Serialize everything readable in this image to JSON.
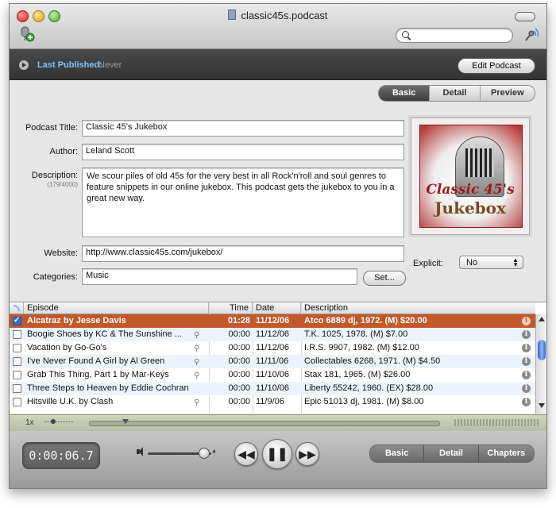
{
  "window": {
    "title": "classic45s.podcast",
    "search_placeholder": ""
  },
  "publish": {
    "label": "Last Published:",
    "value": "Never",
    "edit_button": "Edit Podcast"
  },
  "view_tabs": [
    {
      "label": "Basic",
      "active": true
    },
    {
      "label": "Detail",
      "active": false
    },
    {
      "label": "Preview",
      "active": false
    }
  ],
  "form": {
    "title_label": "Podcast Title:",
    "title_value": "Classic 45's Jukebox",
    "author_label": "Author:",
    "author_value": "Leland Scott",
    "description_label": "Description:",
    "description_count": "(179/4000)",
    "description_value": "We scour piles of old 45s for the very best in all Rock'n'roll and soul genres to feature snippets in our online jukebox.  This podcast gets the jukebox to you in a great new way.",
    "website_label": "Website:",
    "website_value": "http://www.classic45s.com/jukebox/",
    "categories_label": "Categories:",
    "categories_value": "Music",
    "set_button": "Set...",
    "explicit_label": "Explicit:",
    "explicit_value": "No",
    "artwork_text_top": "Classic 45's",
    "artwork_text_bottom": "Jukebox"
  },
  "table": {
    "columns": [
      "Episode",
      "Time",
      "Date",
      "Description"
    ],
    "rows": [
      {
        "episode": "Alcatraz by Jesse Davis",
        "time": "01:28",
        "date": "11/12/06",
        "description": "Atco 6889 dj, 1972. (M) $20.00",
        "checked": true,
        "selected": true,
        "clip": false
      },
      {
        "episode": "Boogie Shoes by KC & The Sunshine ...",
        "time": "00:00",
        "date": "11/12/06",
        "description": "T.K. 1025, 1978. (M) $7.00",
        "checked": false,
        "selected": false,
        "clip": true
      },
      {
        "episode": "Vacation by Go-Go's",
        "time": "00:00",
        "date": "11/12/06",
        "description": "I.R.S. 9907, 1982. (M) $12.00",
        "checked": false,
        "selected": false,
        "clip": true
      },
      {
        "episode": "I've Never Found A Girl by Al Green",
        "time": "00:00",
        "date": "11/11/06",
        "description": "Collectables 6268, 1971. (M) $4.50",
        "checked": false,
        "selected": false,
        "clip": true
      },
      {
        "episode": "Grab This Thing, Part 1 by Mar-Keys",
        "time": "00:00",
        "date": "11/10/06",
        "description": "Stax 181, 1965. (M) $26.00",
        "checked": false,
        "selected": false,
        "clip": true
      },
      {
        "episode": "Three Steps to Heaven by Eddie Cochran",
        "time": "00:00",
        "date": "11/10/06",
        "description": "Liberty 55242, 1960. (EX) $28.00",
        "checked": false,
        "selected": false,
        "clip": false
      },
      {
        "episode": "Hitsville U.K. by Clash",
        "time": "00:00",
        "date": "11/9/06",
        "description": "Epic 51013 dj, 1981. (M) $8.00",
        "checked": false,
        "selected": false,
        "clip": true
      }
    ]
  },
  "playback": {
    "speed": "1x",
    "elapsed": "0:00:06.7"
  },
  "bottom_tabs": [
    {
      "label": "Basic"
    },
    {
      "label": "Detail"
    },
    {
      "label": "Chapters"
    }
  ]
}
